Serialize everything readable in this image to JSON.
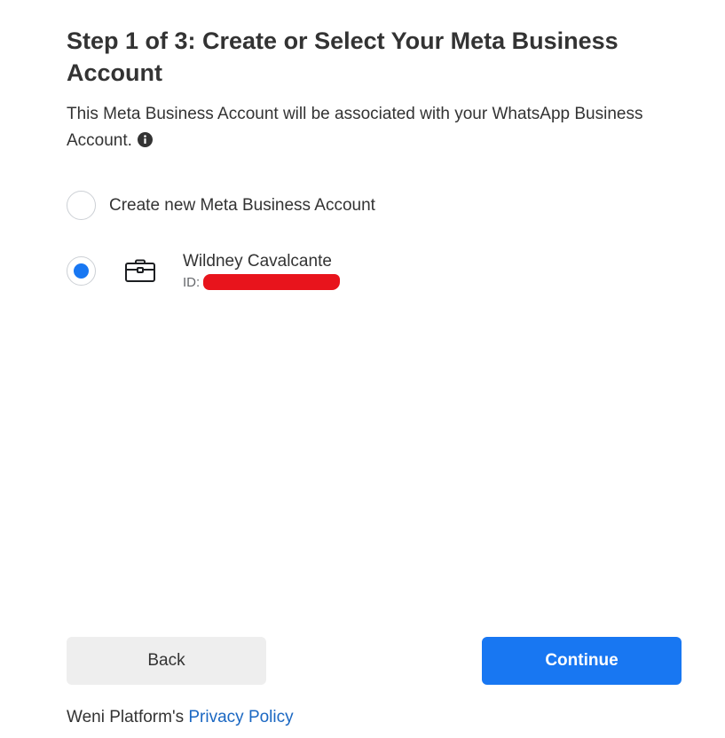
{
  "header": {
    "title": "Step 1 of 3: Create or Select Your Meta Business Account",
    "subtitle": "This Meta Business Account will be associated with your WhatsApp Business Account."
  },
  "options": {
    "create_new": {
      "label": "Create new Meta Business Account",
      "selected": false
    },
    "existing": {
      "name": "Wildney Cavalcante",
      "id_label": "ID:",
      "selected": true,
      "icon": "briefcase-icon"
    }
  },
  "buttons": {
    "back_label": "Back",
    "continue_label": "Continue"
  },
  "footer": {
    "prefix": "Weni Platform's ",
    "link_label": "Privacy Policy"
  },
  "colors": {
    "primary": "#1877f2",
    "link": "#1a67c2",
    "redaction": "#e8141c"
  }
}
